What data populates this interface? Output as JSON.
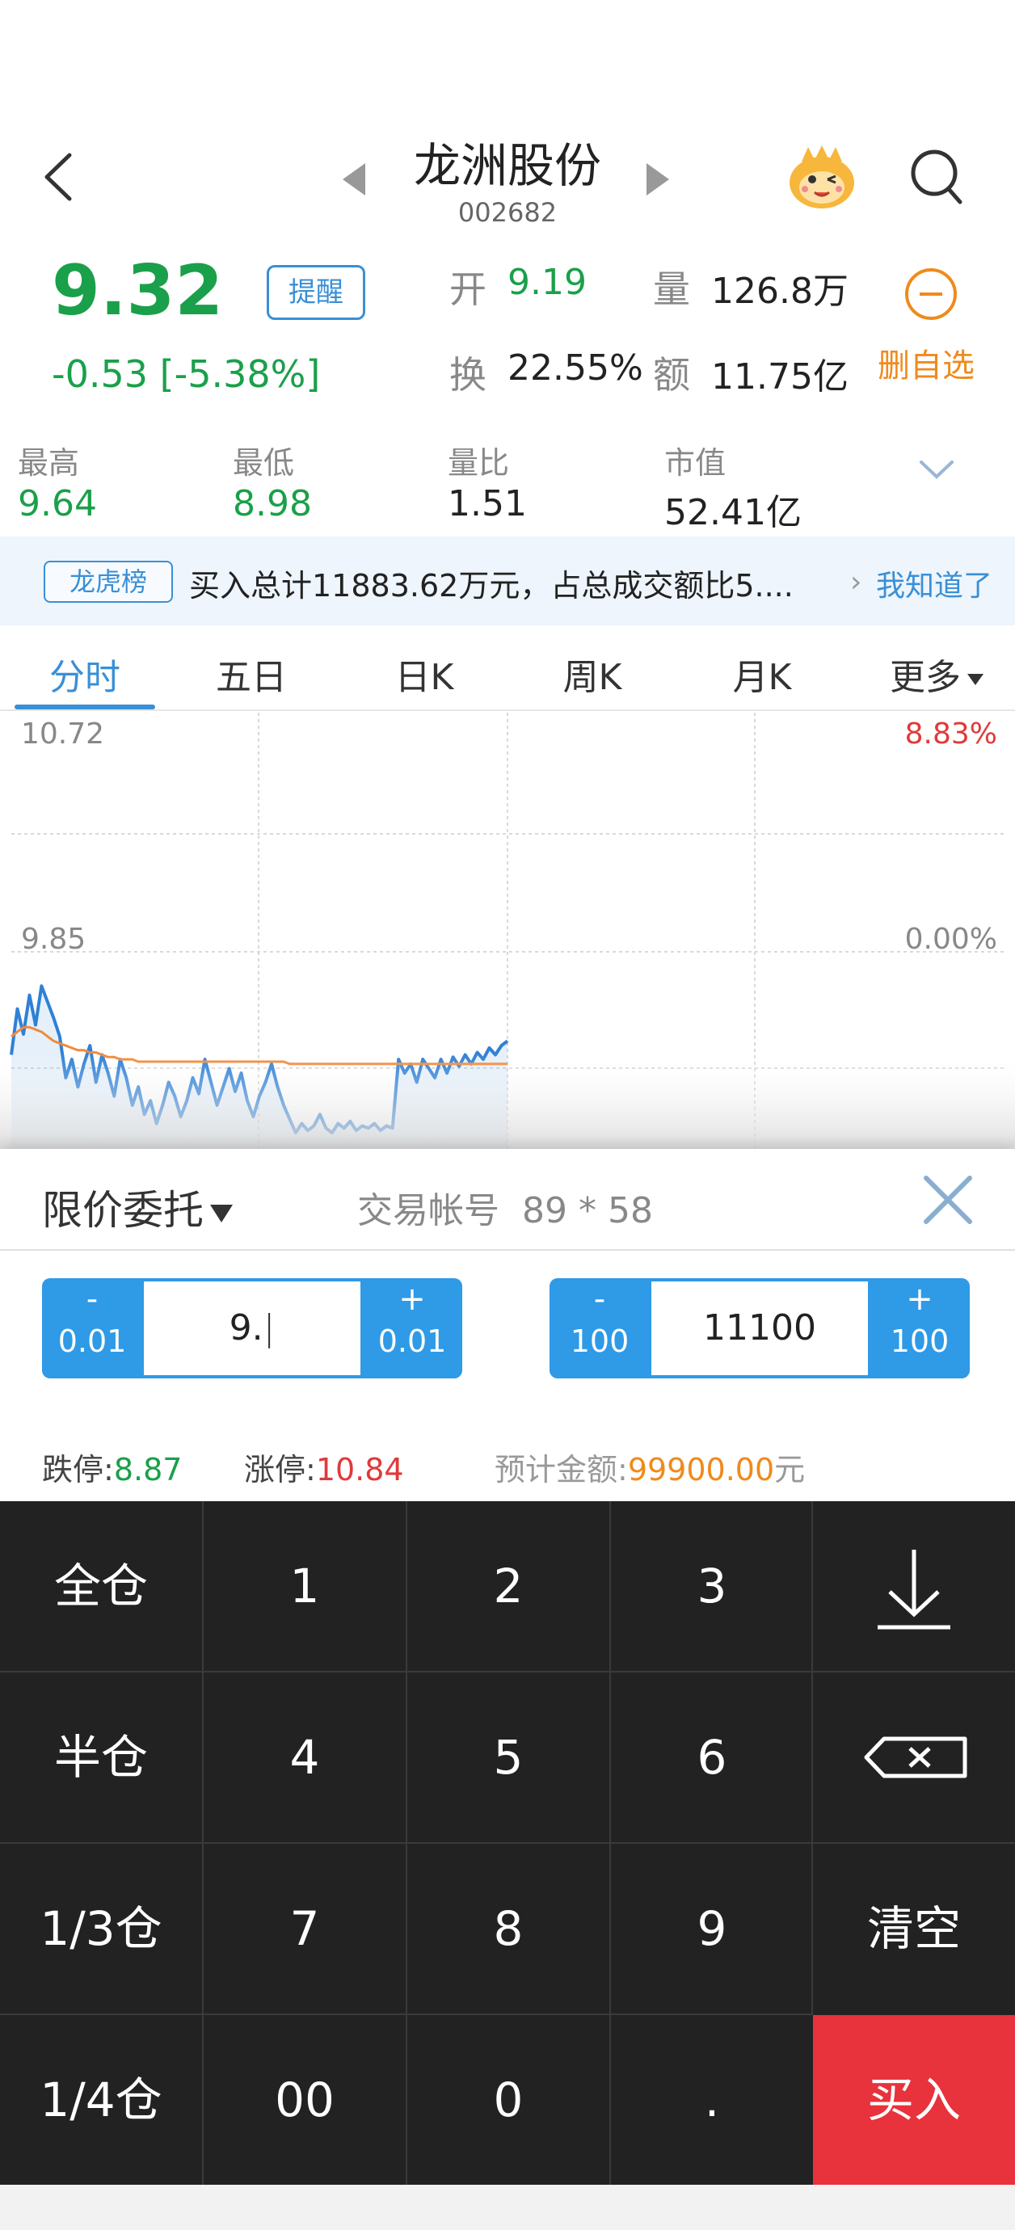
{
  "header": {
    "stock_name": "龙洲股份",
    "stock_code": "002682"
  },
  "quote": {
    "price": "9.32",
    "change": "-0.53 [-5.38%]",
    "remind_label": "提醒",
    "open_label": "开",
    "open_value": "9.19",
    "volume_label": "量",
    "volume_value": "126.8万",
    "turnover_label": "换",
    "turnover_value": "22.55%",
    "amount_label": "额",
    "amount_value": "11.75亿",
    "remove_watchlist_label": "删自选"
  },
  "stats": [
    {
      "label": "最高",
      "value": "9.64",
      "color": "#1aa04a"
    },
    {
      "label": "最低",
      "value": "8.98",
      "color": "#1aa04a"
    },
    {
      "label": "量比",
      "value": "1.51",
      "color": "#222222"
    },
    {
      "label": "市值",
      "value": "52.41亿",
      "color": "#222222"
    }
  ],
  "lhb": {
    "tag": "龙虎榜",
    "text": "买入总计11883.62万元，占总成交额比5....",
    "ack": "我知道了"
  },
  "tabs": [
    {
      "label": "分时",
      "active": true
    },
    {
      "label": "五日"
    },
    {
      "label": "日K"
    },
    {
      "label": "周K"
    },
    {
      "label": "月K"
    },
    {
      "label": "更多"
    }
  ],
  "chart_data": {
    "type": "line",
    "y_left_labels": [
      "10.72",
      "9.85"
    ],
    "y_right_labels": [
      "8.83%",
      "0.00%"
    ],
    "ylim": [
      8.98,
      10.72
    ],
    "grid": true,
    "series": [
      {
        "color": "#2f80d6",
        "values": [
          9.32,
          9.52,
          9.41,
          9.58,
          9.45,
          9.62,
          9.55,
          9.48,
          9.4,
          9.22,
          9.3,
          9.18,
          9.28,
          9.36,
          9.2,
          9.32,
          9.24,
          9.14,
          9.3,
          9.22,
          9.1,
          9.18,
          9.06,
          9.12,
          9.02,
          9.1,
          9.2,
          9.14,
          9.05,
          9.12,
          9.22,
          9.15,
          9.3,
          9.2,
          9.1,
          9.18,
          9.26,
          9.16,
          9.24,
          9.12,
          9.05,
          9.14,
          9.2,
          9.28,
          9.18,
          9.1,
          9.04,
          8.98,
          9.02,
          8.99,
          9.01,
          9.06,
          9.0,
          8.98,
          9.02,
          9.0,
          9.03,
          8.99,
          9.01,
          9.0,
          9.02,
          8.99,
          9.01,
          9.0,
          9.3,
          9.24,
          9.28,
          9.2,
          9.3,
          9.26,
          9.22,
          9.3,
          9.24,
          9.31,
          9.27,
          9.32,
          9.28,
          9.33,
          9.3,
          9.35,
          9.32,
          9.36,
          9.38
        ]
      },
      {
        "color": "#f08a3c",
        "values": [
          9.4,
          9.42,
          9.44,
          9.44,
          9.43,
          9.42,
          9.4,
          9.38,
          9.37,
          9.36,
          9.35,
          9.34,
          9.34,
          9.33,
          9.33,
          9.32,
          9.31,
          9.31,
          9.3,
          9.3,
          9.3,
          9.29,
          9.29,
          9.29,
          9.29,
          9.29,
          9.29,
          9.29,
          9.29,
          9.29,
          9.29,
          9.29,
          9.29,
          9.29,
          9.29,
          9.29,
          9.29,
          9.29,
          9.29,
          9.29,
          9.29,
          9.29,
          9.29,
          9.29,
          9.29,
          9.29,
          9.28,
          9.28,
          9.28,
          9.28,
          9.28,
          9.28,
          9.28,
          9.28,
          9.28,
          9.28,
          9.28,
          9.28,
          9.28,
          9.28,
          9.28,
          9.28,
          9.28,
          9.28,
          9.28,
          9.28,
          9.28,
          9.28,
          9.28,
          9.28,
          9.28,
          9.28,
          9.28,
          9.28,
          9.28,
          9.28,
          9.28,
          9.28,
          9.28,
          9.28,
          9.28,
          9.28,
          9.28
        ]
      }
    ]
  },
  "order": {
    "type": "限价委托",
    "account_label": "交易帐号",
    "account_value": "89 * 58",
    "price_stepper": {
      "minus_sign": "-",
      "minus_amount": "0.01",
      "value": "9.",
      "plus_sign": "+",
      "plus_amount": "0.01"
    },
    "qty_stepper": {
      "minus_sign": "-",
      "minus_amount": "100",
      "value": "11100",
      "plus_sign": "+",
      "plus_amount": "100"
    },
    "limit_down_label": "跌停:",
    "limit_down_value": "8.87",
    "limit_up_label": "涨停:",
    "limit_up_value": "10.84",
    "estimate_label": "预计金额:",
    "estimate_value": "99900.00",
    "estimate_unit": "元"
  },
  "keypad": {
    "full": "全仓",
    "k1": "1",
    "k2": "2",
    "k3": "3",
    "half": "半仓",
    "k4": "4",
    "k5": "5",
    "k6": "6",
    "third": "1/3仓",
    "k7": "7",
    "k8": "8",
    "k9": "9",
    "clear": "清空",
    "quarter": "1/4仓",
    "k00": "00",
    "k0": "0",
    "dot": ".",
    "buy": "买入"
  }
}
